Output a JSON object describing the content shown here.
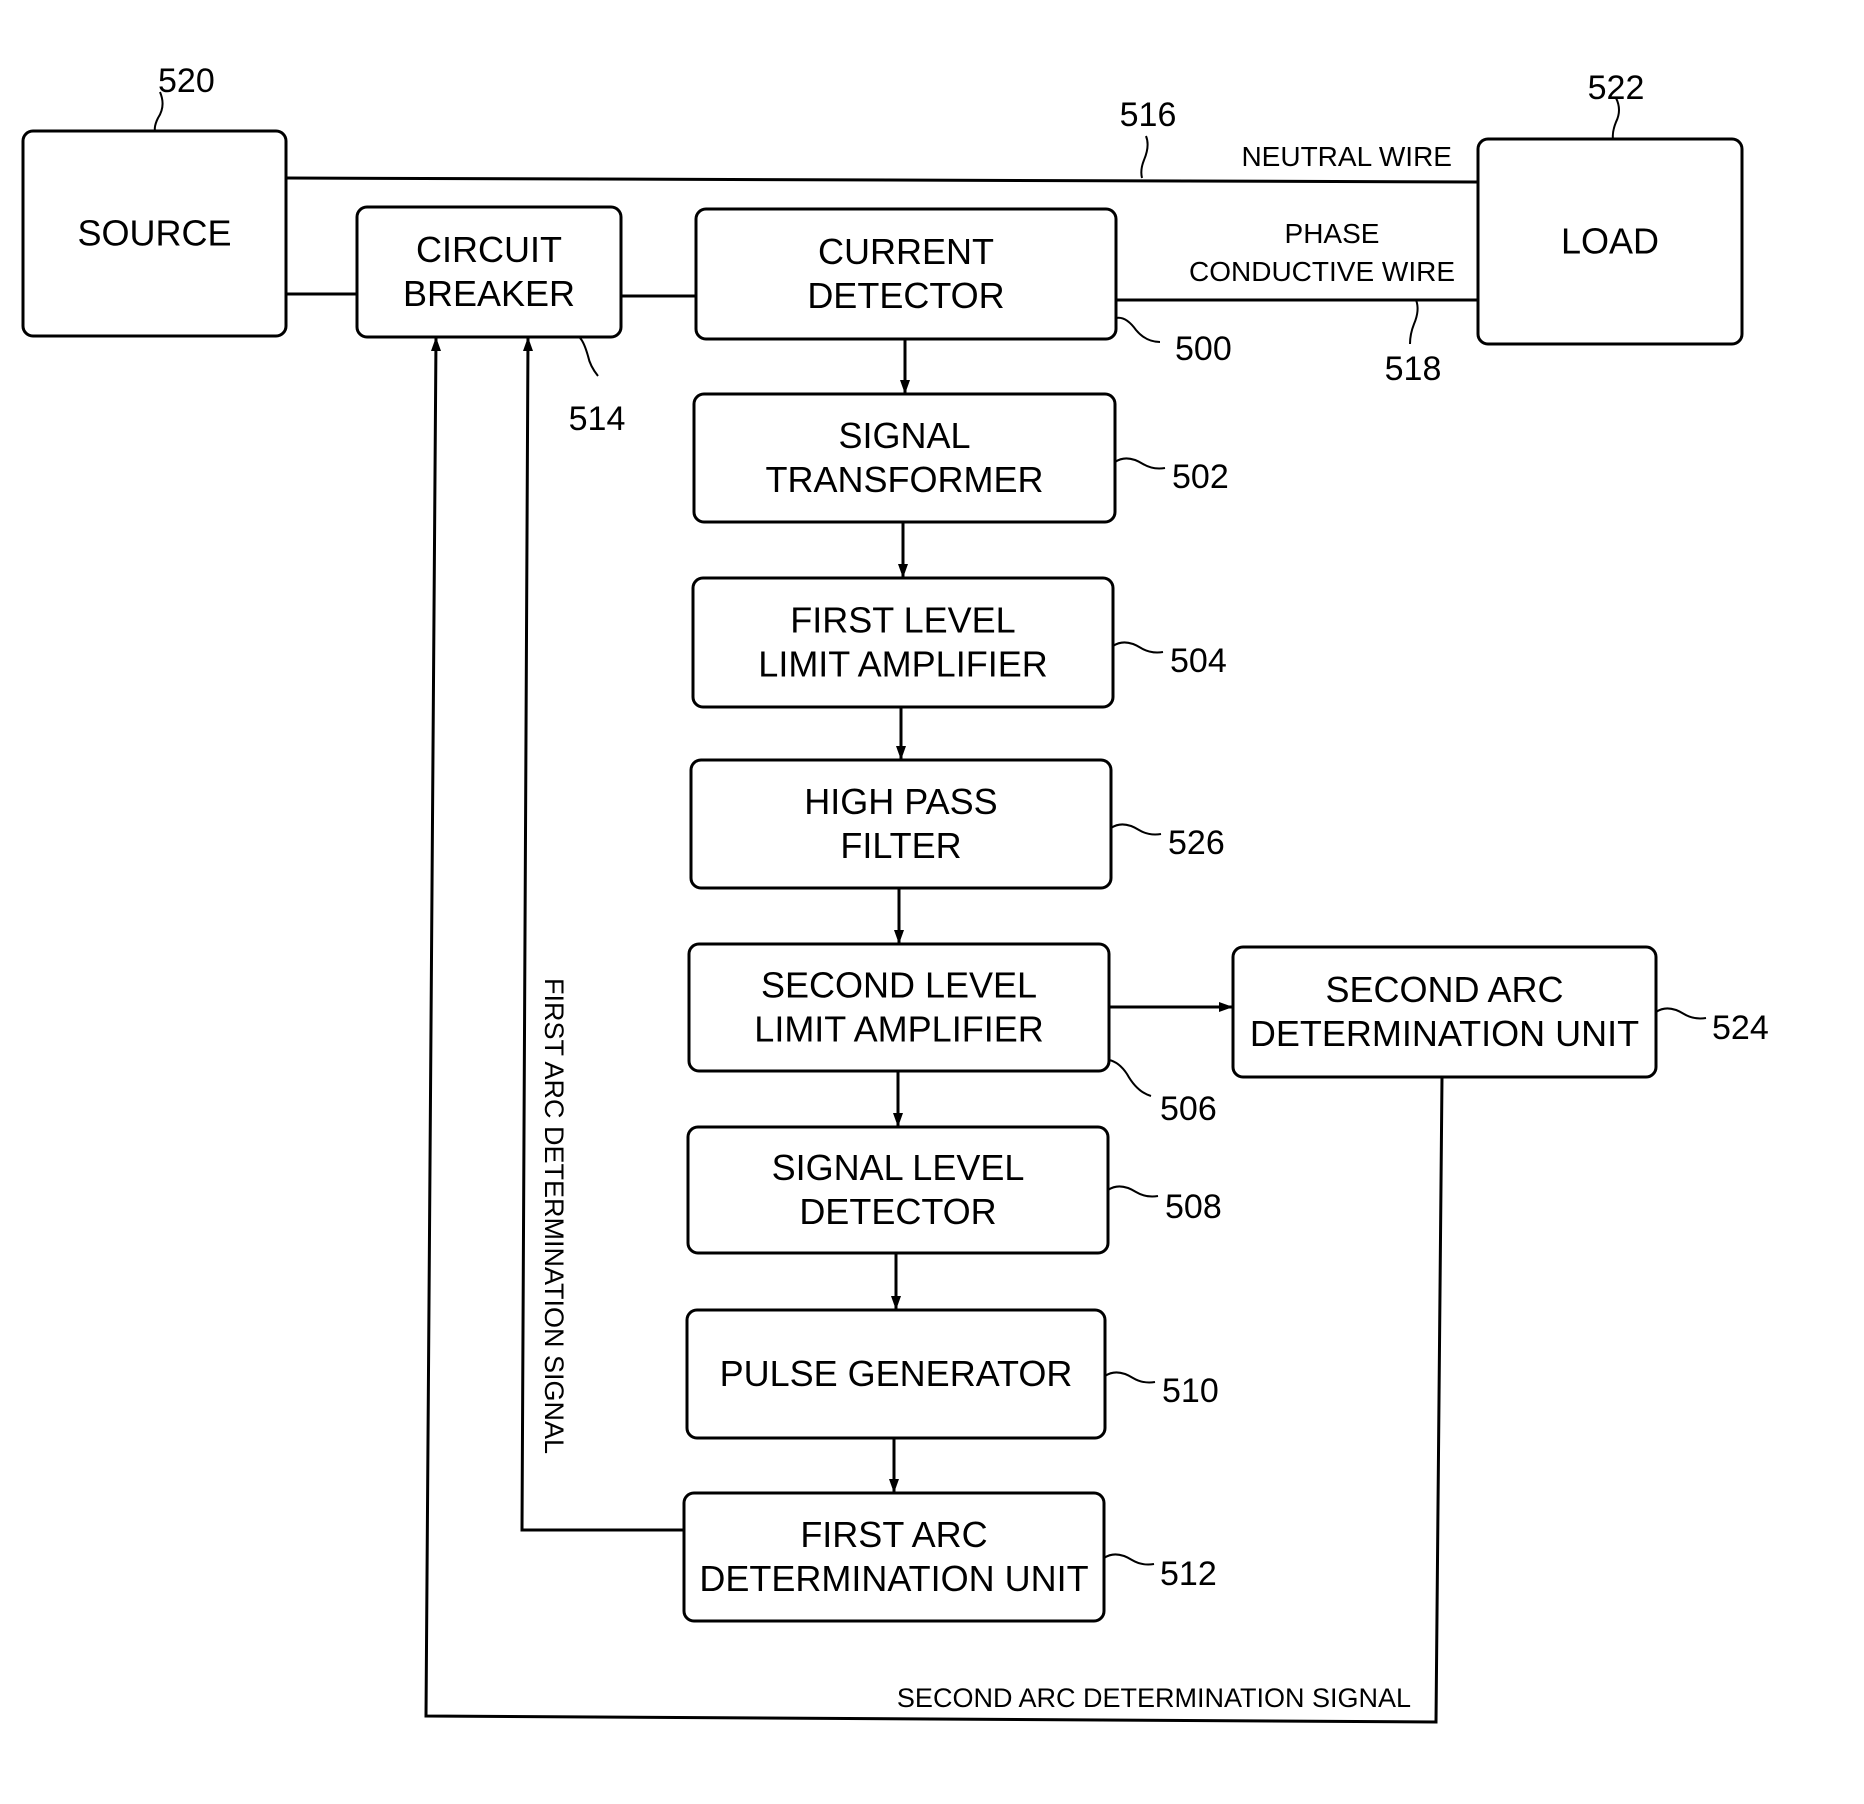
{
  "diagram": {
    "blocks": [
      {
        "id": "source",
        "ref": "520",
        "lines": [
          "SOURCE"
        ]
      },
      {
        "id": "circuit-breaker",
        "ref": "514",
        "lines": [
          "CIRCUIT",
          "BREAKER"
        ]
      },
      {
        "id": "current-detector",
        "ref": "500",
        "lines": [
          "CURRENT",
          "DETECTOR"
        ]
      },
      {
        "id": "load",
        "ref": "522",
        "lines": [
          "LOAD"
        ]
      },
      {
        "id": "signal-transformer",
        "ref": "502",
        "lines": [
          "SIGNAL",
          "TRANSFORMER"
        ]
      },
      {
        "id": "first-level-limit-amplifier",
        "ref": "504",
        "lines": [
          "FIRST LEVEL",
          "LIMIT AMPLIFIER"
        ]
      },
      {
        "id": "high-pass-filter",
        "ref": "526",
        "lines": [
          "HIGH PASS",
          "FILTER"
        ]
      },
      {
        "id": "second-level-limit-amplifier",
        "ref": "506",
        "lines": [
          "SECOND LEVEL",
          "LIMIT AMPLIFIER"
        ]
      },
      {
        "id": "signal-level-detector",
        "ref": "508",
        "lines": [
          "SIGNAL LEVEL",
          "DETECTOR"
        ]
      },
      {
        "id": "pulse-generator",
        "ref": "510",
        "lines": [
          "PULSE GENERATOR"
        ]
      },
      {
        "id": "first-arc-determination-unit",
        "ref": "512",
        "lines": [
          "FIRST ARC",
          "DETERMINATION UNIT"
        ]
      },
      {
        "id": "second-arc-determination-unit",
        "ref": "524",
        "lines": [
          "SECOND ARC",
          "DETERMINATION UNIT"
        ]
      }
    ],
    "wires": {
      "neutral": {
        "ref": "516",
        "label": "NEUTRAL WIRE"
      },
      "phase": {
        "ref": "518",
        "label_lines": [
          "PHASE",
          "CONDUCTIVE WIRE"
        ]
      }
    },
    "signals": {
      "first_arc": "FIRST ARC DETERMINATION SIGNAL",
      "second_arc": "SECOND ARC DETERMINATION SIGNAL"
    },
    "connections": [
      {
        "from": "source",
        "to": "circuit-breaker"
      },
      {
        "from": "circuit-breaker",
        "to": "current-detector"
      },
      {
        "from": "current-detector",
        "to": "load",
        "wire": "phase"
      },
      {
        "from": "source",
        "to": "load",
        "wire": "neutral"
      },
      {
        "from": "current-detector",
        "to": "signal-transformer"
      },
      {
        "from": "signal-transformer",
        "to": "first-level-limit-amplifier"
      },
      {
        "from": "first-level-limit-amplifier",
        "to": "high-pass-filter"
      },
      {
        "from": "high-pass-filter",
        "to": "second-level-limit-amplifier"
      },
      {
        "from": "second-level-limit-amplifier",
        "to": "signal-level-detector"
      },
      {
        "from": "second-level-limit-amplifier",
        "to": "second-arc-determination-unit"
      },
      {
        "from": "signal-level-detector",
        "to": "pulse-generator"
      },
      {
        "from": "pulse-generator",
        "to": "first-arc-determination-unit"
      },
      {
        "from": "first-arc-determination-unit",
        "to": "circuit-breaker",
        "signal": "first_arc"
      },
      {
        "from": "second-arc-determination-unit",
        "to": "circuit-breaker",
        "signal": "second_arc"
      }
    ]
  }
}
